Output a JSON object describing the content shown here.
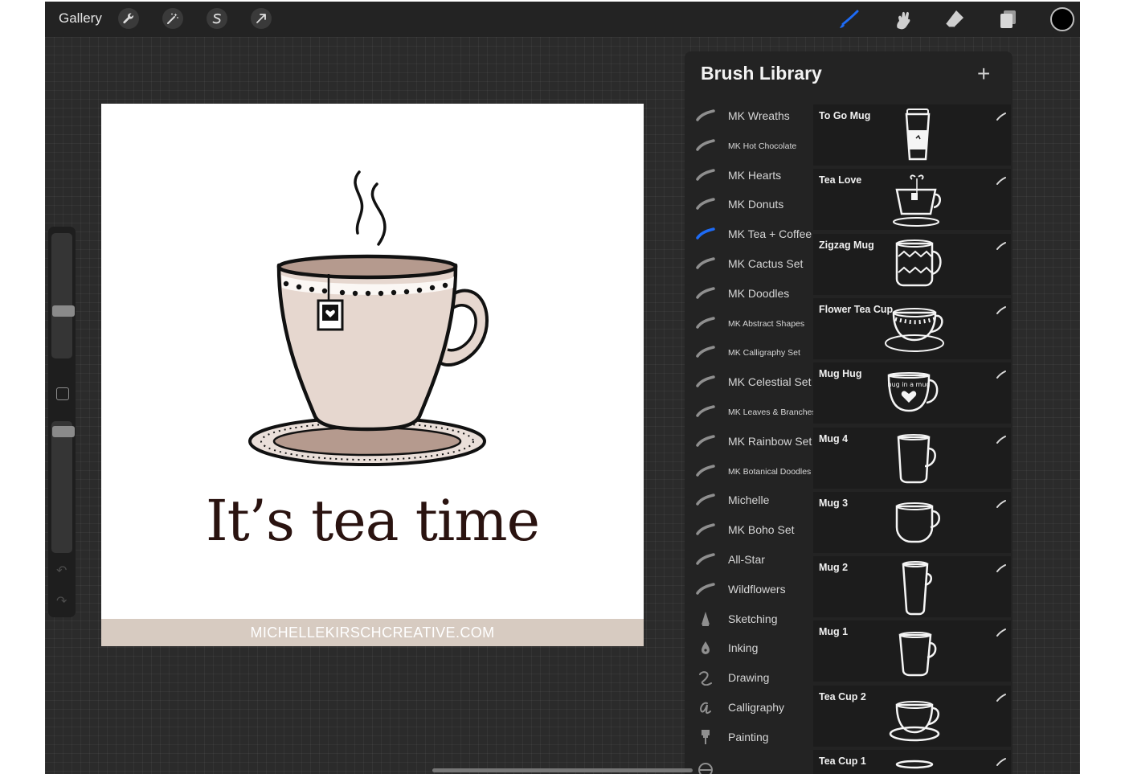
{
  "topbar": {
    "gallery_label": "Gallery",
    "left_tools": [
      "wrench-icon",
      "magic-wand-icon",
      "selection-s-icon",
      "transform-arrow-icon"
    ],
    "right_tools": [
      "brush-icon",
      "smudge-icon",
      "eraser-icon",
      "layers-icon"
    ],
    "active_tool_color": "#1e6bf5",
    "current_color": "#000000"
  },
  "canvas": {
    "headline": "It’s tea time",
    "footer": "MICHELLEKIRSCHCREATIVE.COM",
    "cup_color": "#e6d7cf",
    "tea_color": "#b59a8e",
    "band_color": "#d7cbc1"
  },
  "library": {
    "title": "Brush Library",
    "sets": [
      {
        "label": "MK Wreaths",
        "small": false,
        "icon": "brush-stroke-icon"
      },
      {
        "label": "MK Hot Chocolate",
        "small": true,
        "icon": "brush-stroke-icon"
      },
      {
        "label": "MK Hearts",
        "small": false,
        "icon": "brush-stroke-icon"
      },
      {
        "label": "MK Donuts",
        "small": false,
        "icon": "brush-stroke-icon"
      },
      {
        "label": "MK Tea + Coffee",
        "small": false,
        "icon": "brush-stroke-icon",
        "active": true
      },
      {
        "label": "MK Cactus Set",
        "small": false,
        "icon": "brush-stroke-icon"
      },
      {
        "label": "MK Doodles",
        "small": false,
        "icon": "brush-stroke-icon"
      },
      {
        "label": "MK Abstract Shapes",
        "small": true,
        "icon": "brush-stroke-icon"
      },
      {
        "label": "MK Calligraphy Set",
        "small": true,
        "icon": "brush-stroke-icon"
      },
      {
        "label": "MK Celestial Set",
        "small": false,
        "icon": "brush-stroke-icon"
      },
      {
        "label": "MK Leaves & Branches",
        "small": true,
        "icon": "brush-stroke-icon"
      },
      {
        "label": "MK Rainbow Set",
        "small": false,
        "icon": "brush-stroke-icon"
      },
      {
        "label": "MK Botanical Doodles",
        "small": true,
        "icon": "brush-stroke-icon"
      },
      {
        "label": "Michelle",
        "small": false,
        "icon": "brush-stroke-icon"
      },
      {
        "label": "MK Boho Set",
        "small": false,
        "icon": "brush-stroke-icon"
      },
      {
        "label": "All-Star",
        "small": false,
        "icon": "brush-stroke-icon"
      },
      {
        "label": "Wildflowers",
        "small": false,
        "icon": "brush-stroke-icon"
      },
      {
        "label": "Sketching",
        "small": false,
        "icon": "pencil-icon"
      },
      {
        "label": "Inking",
        "small": false,
        "icon": "ink-drop-icon"
      },
      {
        "label": "Drawing",
        "small": false,
        "icon": "squiggle-icon"
      },
      {
        "label": "Calligraphy",
        "small": false,
        "icon": "calligraphy-a-icon"
      },
      {
        "label": "Painting",
        "small": false,
        "icon": "paint-brush-icon"
      },
      {
        "label": "",
        "small": false,
        "icon": "globe-icon"
      }
    ],
    "brushes": [
      {
        "name": "To Go Mug",
        "preview": "to-go-mug"
      },
      {
        "name": "Tea Love",
        "preview": "tea-love"
      },
      {
        "name": "Zigzag Mug",
        "preview": "zigzag-mug"
      },
      {
        "name": "Flower Tea Cup",
        "preview": "flower-tea-cup"
      },
      {
        "name": "Mug Hug",
        "preview": "mug-hug"
      },
      {
        "name": "Mug 4",
        "preview": "mug4"
      },
      {
        "name": "Mug 3",
        "preview": "mug3"
      },
      {
        "name": "Mug 2",
        "preview": "mug2"
      },
      {
        "name": "Mug 1",
        "preview": "mug1"
      },
      {
        "name": "Tea Cup 2",
        "preview": "teacup2"
      },
      {
        "name": "Tea Cup 1",
        "preview": "teacup1"
      }
    ],
    "mug_hug_text": "hug in a mug"
  }
}
